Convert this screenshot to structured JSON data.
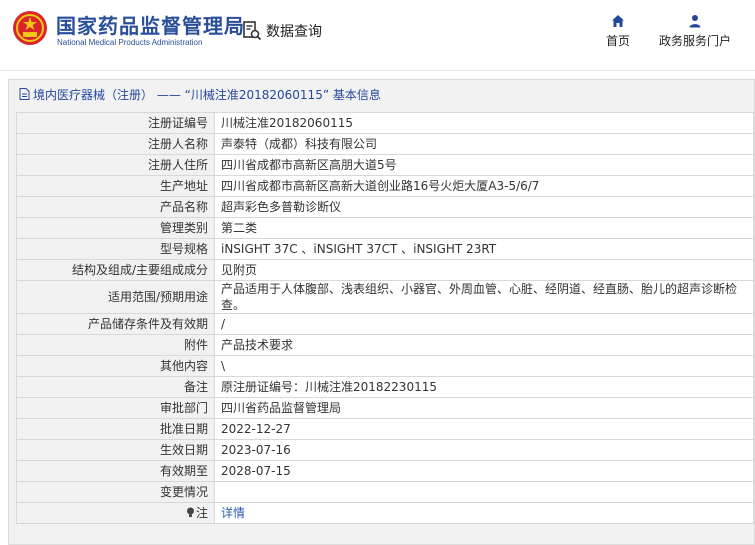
{
  "site": {
    "name_cn": "国家药品监督管理局",
    "name_en": "National Medical Products Administration"
  },
  "header": {
    "query_label": "数据查询",
    "nav": [
      {
        "label": "首页",
        "icon": "home-icon"
      },
      {
        "label": "政务服务门户",
        "icon": "user-icon"
      }
    ]
  },
  "panel": {
    "title": "境内医疗器械（注册） —— “川械注准20182060115” 基本信息"
  },
  "rows": [
    {
      "key": "注册证编号",
      "value": "川械注准20182060115"
    },
    {
      "key": "注册人名称",
      "value": "声泰特（成都）科技有限公司"
    },
    {
      "key": "注册人住所",
      "value": "四川省成都市高新区高朋大道5号"
    },
    {
      "key": "生产地址",
      "value": "四川省成都市高新区高新大道创业路16号火炬大厦A3-5/6/7"
    },
    {
      "key": "产品名称",
      "value": "超声彩色多普勒诊断仪"
    },
    {
      "key": "管理类别",
      "value": "第二类"
    },
    {
      "key": "型号规格",
      "value": "iNSIGHT 37C 、iNSIGHT 37CT 、iNSIGHT 23RT"
    },
    {
      "key": "结构及组成/主要组成成分",
      "value": "见附页"
    },
    {
      "key": "适用范围/预期用途",
      "value": "产品适用于人体腹部、浅表组织、小器官、外周血管、心脏、经阴道、经直肠、胎儿的超声诊断检查。"
    },
    {
      "key": "产品储存条件及有效期",
      "value": "/"
    },
    {
      "key": "附件",
      "value": "产品技术要求"
    },
    {
      "key": "其他内容",
      "value": "\\"
    },
    {
      "key": "备注",
      "value": "原注册证编号：川械注准20182230115"
    },
    {
      "key": "审批部门",
      "value": "四川省药品监督管理局"
    },
    {
      "key": "批准日期",
      "value": "2022-12-27"
    },
    {
      "key": "生效日期",
      "value": "2023-07-16"
    },
    {
      "key": "有效期至",
      "value": "2028-07-15"
    },
    {
      "key": "变更情况",
      "value": ""
    },
    {
      "key": "注",
      "value": "详情"
    }
  ],
  "colors": {
    "brand": "#2a4f9a",
    "link": "#2a5db0",
    "label_bg": "#f1f1f1"
  }
}
